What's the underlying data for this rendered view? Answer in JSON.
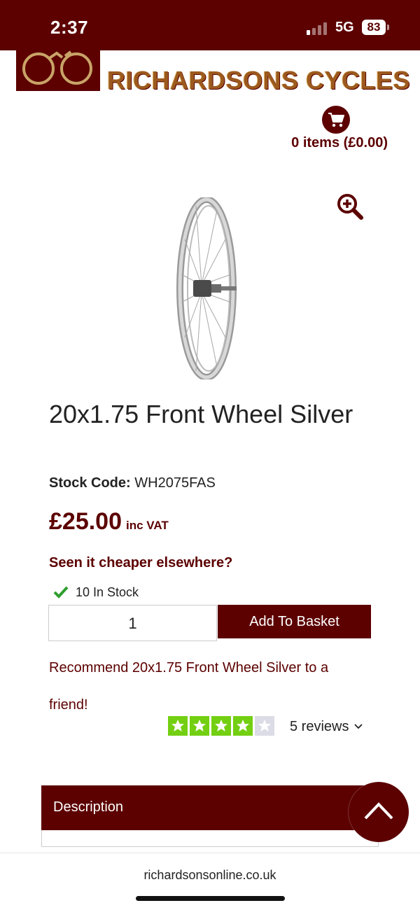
{
  "status_bar": {
    "time": "2:37",
    "network": "5G",
    "battery": "83"
  },
  "header": {
    "logo_text": "RICHARDSONS CYCLES",
    "cart_icon": "shopping-cart-icon",
    "cart_summary": "0 items (£0.00)",
    "zoom_icon": "zoom-in-icon"
  },
  "product": {
    "image": "silver-front-wheel",
    "title": "20x1.75 Front Wheel Silver",
    "stock_code_label": "Stock Code:",
    "stock_code": "WH2075FAS",
    "price": "£25.00",
    "price_suffix": "inc VAT",
    "cheaper_link": "Seen it cheaper elsewhere?",
    "stock_status": "10 In Stock",
    "quantity": "1",
    "add_to_basket": "Add To Basket",
    "recommend_link": "Recommend 20x1.75 Front Wheel Silver to a friend!"
  },
  "reviews": {
    "rating": 4,
    "max_rating": 5,
    "count_text": "5 reviews"
  },
  "tabs": {
    "description": "Description"
  },
  "browser": {
    "url": "richardsonsonline.co.uk"
  },
  "colors": {
    "brand": "#5c0000",
    "logo_text": "#9c5a1e",
    "star_green": "#73cf11",
    "in_stock_check": "#2e9e2e"
  }
}
